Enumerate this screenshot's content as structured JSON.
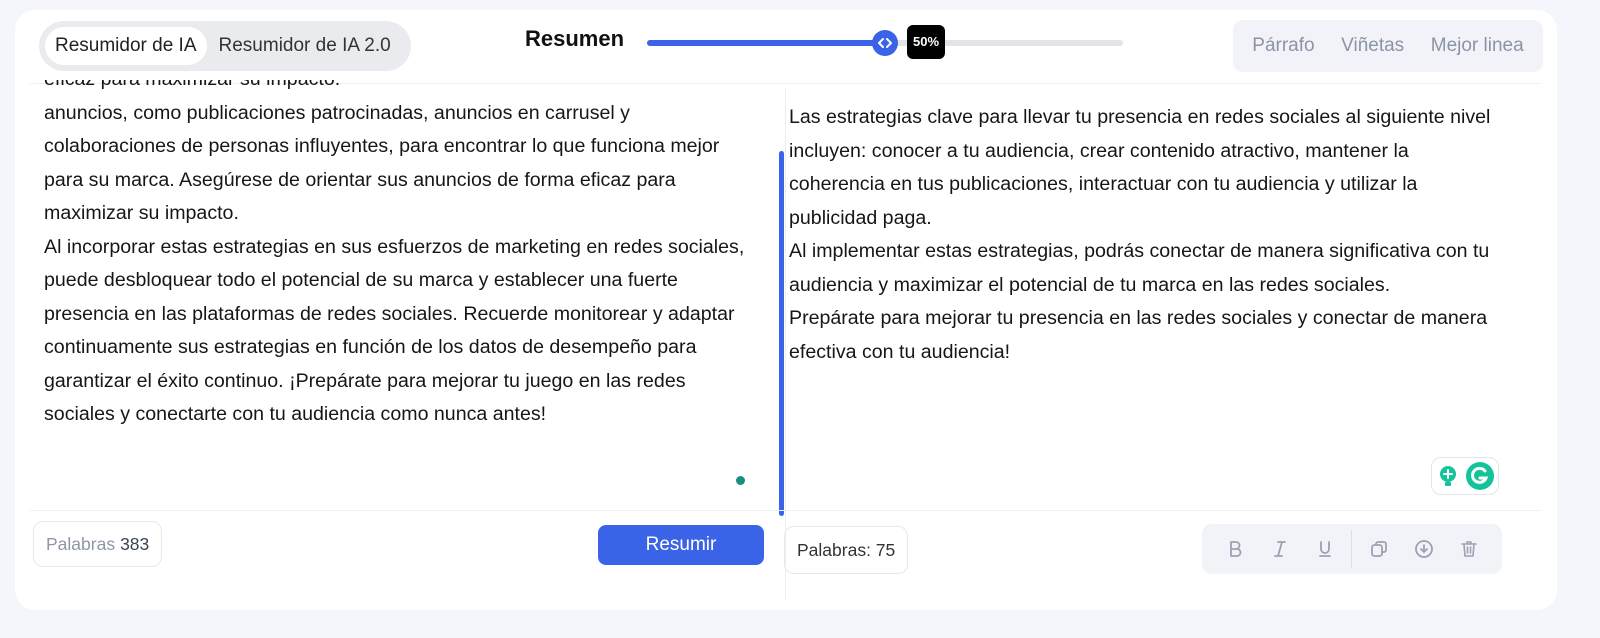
{
  "header": {
    "mode_options": [
      "Resumidor de IA",
      "Resumidor de IA 2.0"
    ],
    "active_mode": 0,
    "summary_label": "Resumen",
    "slider": {
      "value": 0.5,
      "tooltip": "50%"
    },
    "format_options": [
      "Párrafo",
      "Viñetas",
      "Mejor linea"
    ]
  },
  "input": {
    "paragraphs": [
      "eficaz para maximizar su impacto.",
      "anuncios, como publicaciones patrocinadas, anuncios en carrusel y colaboraciones de personas influyentes, para encontrar lo que funciona mejor para su marca. Asegúrese de orientar sus anuncios de forma eficaz para maximizar su impacto.",
      "Al incorporar estas estrategias en sus esfuerzos de marketing en redes sociales, puede desbloquear todo el potencial de su marca y establecer una fuerte presencia en las plataformas de redes sociales. Recuerde monitorear y adaptar continuamente sus estrategias en función de los datos de desempeño para garantizar el éxito continuo. ¡Prepárate para mejorar tu juego en las redes sociales y conectarte con tu audiencia como nunca antes!"
    ],
    "word_count_label": "Palabras",
    "word_count": "383",
    "summarize_label": "Resumir"
  },
  "output": {
    "paragraphs": [
      "Las estrategias clave para llevar tu presencia en redes sociales al siguiente nivel incluyen: conocer a tu audiencia, crear contenido atractivo, mantener la coherencia en tus publicaciones, interactuar con tu audiencia y utilizar la publicidad paga.",
      "Al implementar estas estrategias, podrás conectar de manera significativa con tu audiencia y maximizar el potencial de tu marca en las redes sociales.",
      "Prepárate para mejorar tu presencia en las redes sociales y conectar de manera efectiva con tu audiencia!"
    ],
    "word_count_label": "Palabras: 75"
  },
  "toolbar": {
    "tools": [
      "bold-icon",
      "italic-icon",
      "underline-icon",
      "copy-icon",
      "download-icon",
      "delete-icon"
    ]
  },
  "colors": {
    "accent": "#3b63e8",
    "grammarly": "#15c39a"
  }
}
